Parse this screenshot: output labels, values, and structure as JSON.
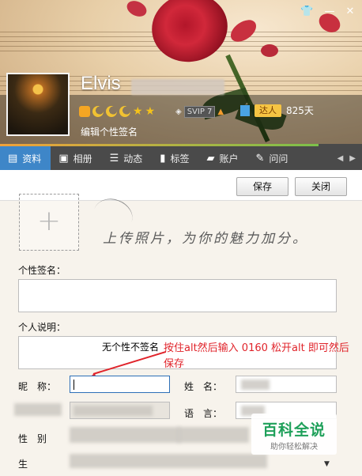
{
  "header": {
    "nickname": "Elvis",
    "edit_sign_label": "编辑个性签名",
    "svip_label": "SVIP 7",
    "daren_label": "达人",
    "days_label": "825天",
    "progress_fraction": 0.88
  },
  "tabs": [
    {
      "label": "资料",
      "icon": "id-card-icon"
    },
    {
      "label": "相册",
      "icon": "photo-icon"
    },
    {
      "label": "动态",
      "icon": "list-icon"
    },
    {
      "label": "标签",
      "icon": "bookmark-icon"
    },
    {
      "label": "账户",
      "icon": "briefcase-icon"
    },
    {
      "label": "问问",
      "icon": "question-icon"
    }
  ],
  "toolbar": {
    "save_label": "保存",
    "close_label": "关闭"
  },
  "upload_hint": "上传照片，为你的魅力加分。",
  "form": {
    "signature_label": "个性签名：",
    "description_label": "个人说明：",
    "default_sign_text": "无个性不签名",
    "nickname_label": "昵　称：",
    "name_label": "姓　名：",
    "language_label": "语　言：",
    "gender_label": "性　别",
    "birthday_label": "生"
  },
  "annotation": "按住alt然后输入 0160 松开alt 即可然后保存",
  "watermark": {
    "title": "百科全说",
    "subtitle": "助你轻松解决"
  },
  "colors": {
    "active_tab": "#3e86c8",
    "annotation": "#e0232a",
    "watermark_green": "#1fa05a"
  }
}
